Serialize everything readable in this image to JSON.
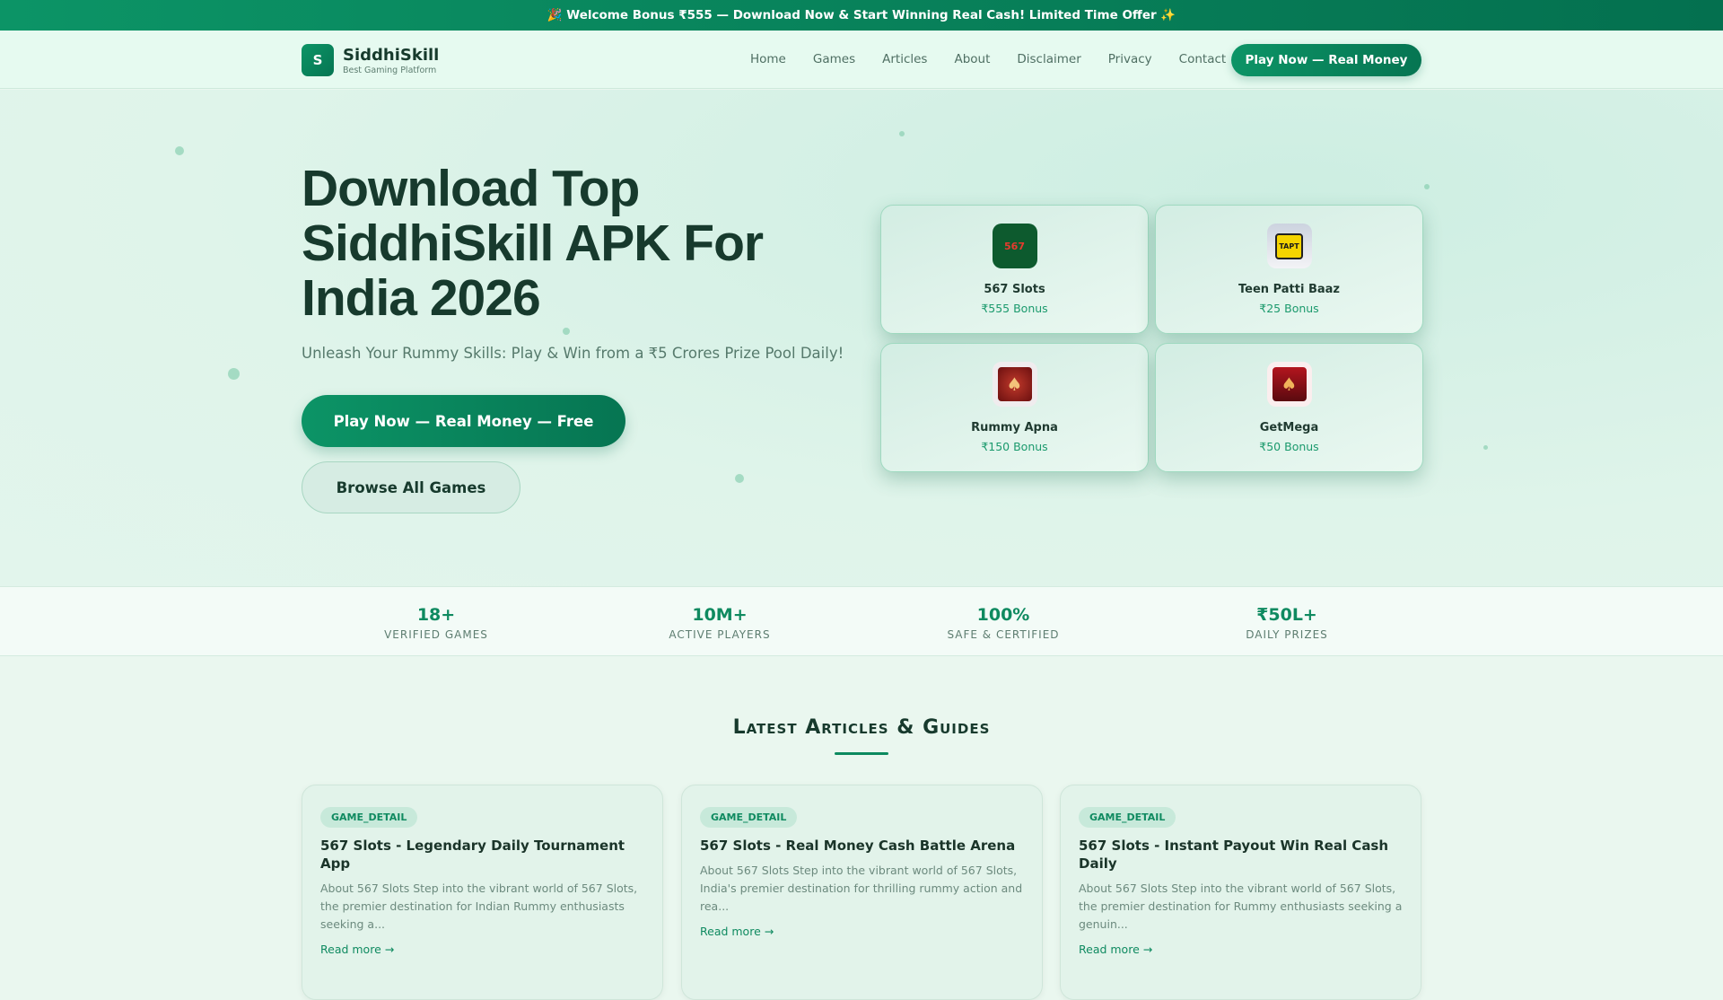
{
  "banner": "🎉 Welcome Bonus ₹555 — Download Now & Start Winning Real Cash! Limited Time Offer ✨",
  "nav": {
    "logo_letter": "S",
    "brand": "SiddhiSkill",
    "tagline": "Best Gaming Platform",
    "links": [
      "Home",
      "Games",
      "Articles",
      "About",
      "Disclaimer",
      "Privacy",
      "Contact"
    ],
    "cta": "Play Now — Real Money"
  },
  "hero": {
    "title": "Download Top SiddhiSkill APK For India 2026",
    "subtitle": "Unleash Your Rummy Skills: Play & Win from a ₹5 Crores Prize Pool Daily!",
    "primary_button": "Play Now — Real Money — Free",
    "secondary_button": "Browse All Games"
  },
  "games": [
    {
      "name": "567 Slots",
      "bonus": "₹555 Bonus",
      "icon_text": "567"
    },
    {
      "name": "Teen Patti Baaz",
      "bonus": "₹25 Bonus",
      "icon_text": "TAPT"
    },
    {
      "name": "Rummy Apna",
      "bonus": "₹150 Bonus",
      "icon_text": "♠"
    },
    {
      "name": "GetMega",
      "bonus": "₹50 Bonus",
      "icon_text": "♠"
    }
  ],
  "stats": [
    {
      "value": "18+",
      "label": "VERIFIED GAMES"
    },
    {
      "value": "10M+",
      "label": "ACTIVE PLAYERS"
    },
    {
      "value": "100%",
      "label": "SAFE & CERTIFIED"
    },
    {
      "value": "₹50L+",
      "label": "DAILY PRIZES"
    }
  ],
  "articles_section": {
    "title": "Latest Articles & Guides",
    "read_more": "Read more →"
  },
  "articles": [
    {
      "badge": "GAME_DETAIL",
      "title": "567 Slots - Legendary Daily Tournament App",
      "excerpt": "About 567 Slots Step into the vibrant world of 567 Slots, the premier destination for Indian Rummy enthusiasts seeking a..."
    },
    {
      "badge": "GAME_DETAIL",
      "title": "567 Slots - Real Money Cash Battle Arena",
      "excerpt": "About 567 Slots Step into the vibrant world of 567 Slots, India's premier destination for thrilling rummy action and rea..."
    },
    {
      "badge": "GAME_DETAIL",
      "title": "567 Slots - Instant Payout Win Real Cash Daily",
      "excerpt": "About 567 Slots Step into the vibrant world of 567 Slots, the premier destination for Rummy enthusiasts seeking a genuin..."
    }
  ]
}
